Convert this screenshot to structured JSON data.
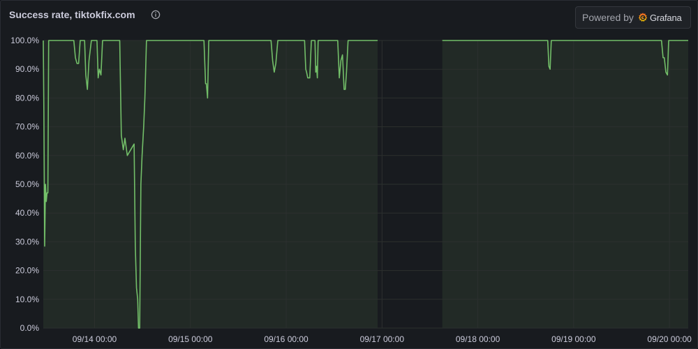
{
  "panel": {
    "title": "Success rate, tiktokfix.com",
    "info_icon": "info-circle-icon",
    "powered_by": {
      "text": "Powered by",
      "brand": "Grafana",
      "logo_icon": "grafana-logo-icon"
    }
  },
  "colors": {
    "background": "#181b1f",
    "line": "#73bf69",
    "data_fill": "#222a26",
    "gap_fill": "#181b1f",
    "grid": "#2c302f",
    "text": "#ccccdc"
  },
  "chart_data": {
    "type": "line",
    "title": "Success rate, tiktokfix.com",
    "xlabel": "",
    "ylabel": "",
    "x_unit": "hours since 09/13 00:00",
    "xlim": [
      11.15,
      172.7
    ],
    "ylim": [
      0,
      100
    ],
    "y_ticks": [
      0,
      10,
      20,
      30,
      40,
      50,
      60,
      70,
      80,
      90,
      100
    ],
    "y_tick_labels": [
      "0.0%",
      "10.0%",
      "20.0%",
      "30.0%",
      "40.0%",
      "50.0%",
      "60.0%",
      "70.0%",
      "80.0%",
      "90.0%",
      "100.0%"
    ],
    "x_ticks": [
      24,
      48,
      72,
      96,
      120,
      144,
      168
    ],
    "x_tick_labels": [
      "09/14 00:00",
      "09/15 00:00",
      "09/16 00:00",
      "09/17 00:00",
      "09/18 00:00",
      "09/19 00:00",
      "09/20 00:00"
    ],
    "grid": true,
    "legend": "none",
    "no_data_ranges": [
      [
        94.9,
        111.1
      ]
    ],
    "series": [
      {
        "name": "",
        "segments": [
          {
            "x": [
              11.15,
              11.3,
              11.5,
              11.7,
              11.9,
              12.1,
              12.3,
              12.5,
              12.7,
              13.2,
              18.8,
              19.2,
              19.6,
              20.0,
              20.4,
              21.5,
              21.8,
              22.2,
              22.6,
              23.2,
              24.6,
              24.9,
              25.2,
              25.6,
              26.0,
              29.8,
              30.3,
              30.7,
              31.2,
              31.6,
              32.2,
              33.9,
              34.2,
              34.5,
              34.8,
              35.0,
              35.3,
              35.6,
              35.9,
              36.3,
              36.6,
              36.8,
              37.0,
              37.3,
              37.9,
              38.4,
              38.8,
              39.5,
              40.2,
              40.7,
              51.4,
              51.8,
              52.0,
              52.3,
              52.6,
              53.2,
              68.2,
              68.6,
              69.0,
              69.4,
              69.9,
              76.6,
              76.9,
              77.1,
              77.4,
              77.9,
              78.3,
              78.8,
              79.2,
              79.4,
              79.6,
              79.8,
              80.0,
              80.3,
              80.6,
              80.8,
              84.9,
              85.3,
              85.7,
              86.1,
              86.5,
              86.8,
              87.1,
              87.5,
              87.8,
              88.1,
              88.5,
              88.8,
              94.9
            ],
            "y": [
              100,
              75,
              28.5,
              50,
              44,
              47,
              47,
              100,
              100,
              100,
              100,
              94,
              92,
              92,
              100,
              100,
              88,
              83,
              93,
              100,
              100,
              87,
              90,
              88,
              100,
              100,
              100,
              67,
              62,
              66,
              60,
              64,
              28.5,
              14,
              10,
              0,
              0,
              50,
              60,
              70,
              80,
              90,
              100,
              100,
              100,
              100,
              100,
              100,
              100,
              100,
              100,
              85,
              85,
              80,
              100,
              100,
              100,
              93,
              89,
              92,
              100,
              100,
              90,
              89,
              87,
              87,
              100,
              100,
              100,
              89,
              91,
              87,
              100,
              100,
              100,
              100,
              100,
              87,
              93,
              95,
              83,
              83,
              89,
              100,
              100,
              100,
              100,
              100,
              100
            ],
            "connect": "line"
          },
          {
            "x": [
              111.1,
              116.5,
              137.5,
              137.8,
              138.1,
              138.4,
              138.8,
              149.0,
              166.0,
              166.4,
              166.7,
              167.1,
              167.5,
              167.8,
              168.2,
              172.7
            ],
            "y": [
              100,
              100,
              100,
              91,
              90,
              100,
              100,
              100,
              100,
              94,
              94,
              89,
              88,
              100,
              100,
              100
            ],
            "connect": "line"
          }
        ]
      }
    ]
  }
}
